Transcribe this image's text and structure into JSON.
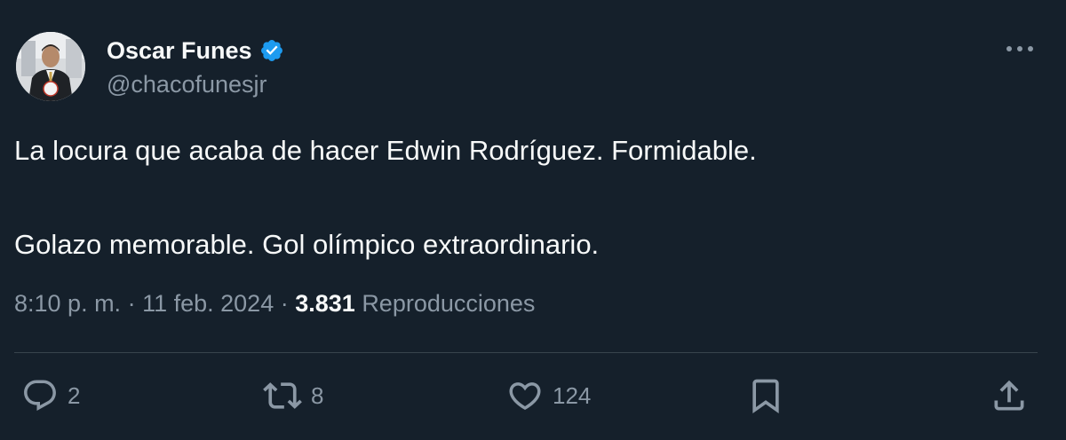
{
  "author": {
    "display_name": "Oscar Funes",
    "handle": "@chacofunesjr"
  },
  "tweet": {
    "paragraphs": [
      "La locura que acaba de hacer Edwin Rodríguez. Formidable.",
      "Golazo memorable. Gol olímpico extraordinario."
    ]
  },
  "meta": {
    "time": "8:10 p. m.",
    "sep1": " · ",
    "date": "11 feb. 2024",
    "sep2": " · ",
    "views": "3.831",
    "views_label": "Reproducciones"
  },
  "actions": {
    "replies": "2",
    "retweets": "8",
    "likes": "124"
  },
  "icons": {
    "verified": "verified-badge-icon",
    "more": "more-horizontal-icon",
    "reply": "reply-icon",
    "retweet": "retweet-icon",
    "like": "heart-icon",
    "bookmark": "bookmark-icon",
    "share": "share-icon"
  },
  "colors": {
    "background": "#15202b",
    "text": "#f7f9f9",
    "secondary": "#8b98a5",
    "accent": "#1d9bf0",
    "divider": "#38444d"
  }
}
